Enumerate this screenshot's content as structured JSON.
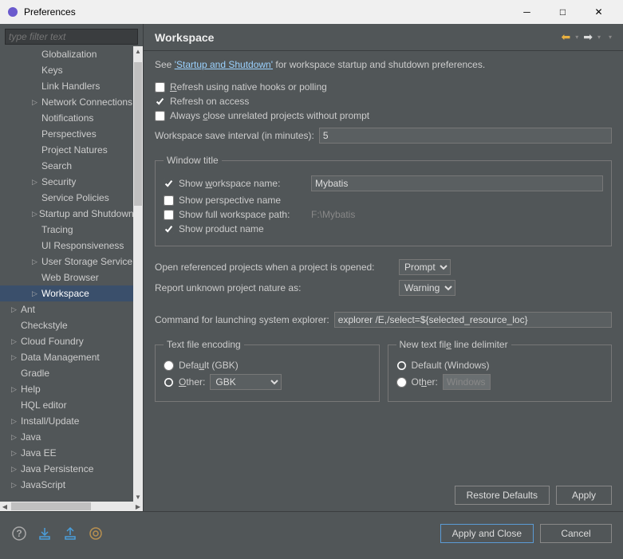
{
  "window": {
    "title": "Preferences"
  },
  "filter": {
    "placeholder": "type filter text"
  },
  "tree": [
    {
      "label": "Globalization",
      "level": 2,
      "arrow": ""
    },
    {
      "label": "Keys",
      "level": 2,
      "arrow": ""
    },
    {
      "label": "Link Handlers",
      "level": 2,
      "arrow": ""
    },
    {
      "label": "Network Connections",
      "level": 2,
      "arrow": "▷"
    },
    {
      "label": "Notifications",
      "level": 2,
      "arrow": ""
    },
    {
      "label": "Perspectives",
      "level": 2,
      "arrow": ""
    },
    {
      "label": "Project Natures",
      "level": 2,
      "arrow": ""
    },
    {
      "label": "Search",
      "level": 2,
      "arrow": ""
    },
    {
      "label": "Security",
      "level": 2,
      "arrow": "▷"
    },
    {
      "label": "Service Policies",
      "level": 2,
      "arrow": ""
    },
    {
      "label": "Startup and Shutdown",
      "level": 2,
      "arrow": "▷"
    },
    {
      "label": "Tracing",
      "level": 2,
      "arrow": ""
    },
    {
      "label": "UI Responsiveness",
      "level": 2,
      "arrow": ""
    },
    {
      "label": "User Storage Service",
      "level": 2,
      "arrow": "▷"
    },
    {
      "label": "Web Browser",
      "level": 2,
      "arrow": ""
    },
    {
      "label": "Workspace",
      "level": 2,
      "arrow": "▷",
      "selected": true
    },
    {
      "label": "Ant",
      "level": 1,
      "arrow": "▷"
    },
    {
      "label": "Checkstyle",
      "level": 1,
      "arrow": ""
    },
    {
      "label": "Cloud Foundry",
      "level": 1,
      "arrow": "▷"
    },
    {
      "label": "Data Management",
      "level": 1,
      "arrow": "▷"
    },
    {
      "label": "Gradle",
      "level": 1,
      "arrow": ""
    },
    {
      "label": "Help",
      "level": 1,
      "arrow": "▷"
    },
    {
      "label": "HQL editor",
      "level": 1,
      "arrow": ""
    },
    {
      "label": "Install/Update",
      "level": 1,
      "arrow": "▷"
    },
    {
      "label": "Java",
      "level": 1,
      "arrow": "▷"
    },
    {
      "label": "Java EE",
      "level": 1,
      "arrow": "▷"
    },
    {
      "label": "Java Persistence",
      "level": 1,
      "arrow": "▷"
    },
    {
      "label": "JavaScript",
      "level": 1,
      "arrow": "▷"
    }
  ],
  "header": {
    "title": "Workspace"
  },
  "intro": {
    "prefix": "See ",
    "link": "'Startup and Shutdown'",
    "suffix": " for workspace startup and shutdown preferences."
  },
  "checks": {
    "refresh_hooks": "Refresh using native hooks or polling",
    "refresh_access": "Refresh on access",
    "close_unrelated": "Always close unrelated projects without prompt"
  },
  "save_interval": {
    "label": "Workspace save interval (in minutes):",
    "value": "5"
  },
  "window_title": {
    "legend": "Window title",
    "show_ws_name": "Show workspace name:",
    "ws_name_value": "Mybatis",
    "show_perspective": "Show perspective name",
    "show_full_path": "Show full workspace path:",
    "full_path_value": "F:\\Mybatis",
    "show_product": "Show product name"
  },
  "open_ref": {
    "label": "Open referenced projects when a project is opened:",
    "value": "Prompt"
  },
  "report_nature": {
    "label": "Report unknown project nature as:",
    "value": "Warning"
  },
  "explorer": {
    "label": "Command for launching system explorer:",
    "value": "explorer /E,/select=${selected_resource_loc}"
  },
  "encoding": {
    "legend": "Text file encoding",
    "default": "Default (GBK)",
    "other": "Other:",
    "other_value": "GBK"
  },
  "delimiter": {
    "legend": "New text file line delimiter",
    "default": "Default (Windows)",
    "other": "Other:",
    "other_value": "Windows"
  },
  "buttons": {
    "restore": "Restore Defaults",
    "apply": "Apply",
    "apply_close": "Apply and Close",
    "cancel": "Cancel"
  }
}
